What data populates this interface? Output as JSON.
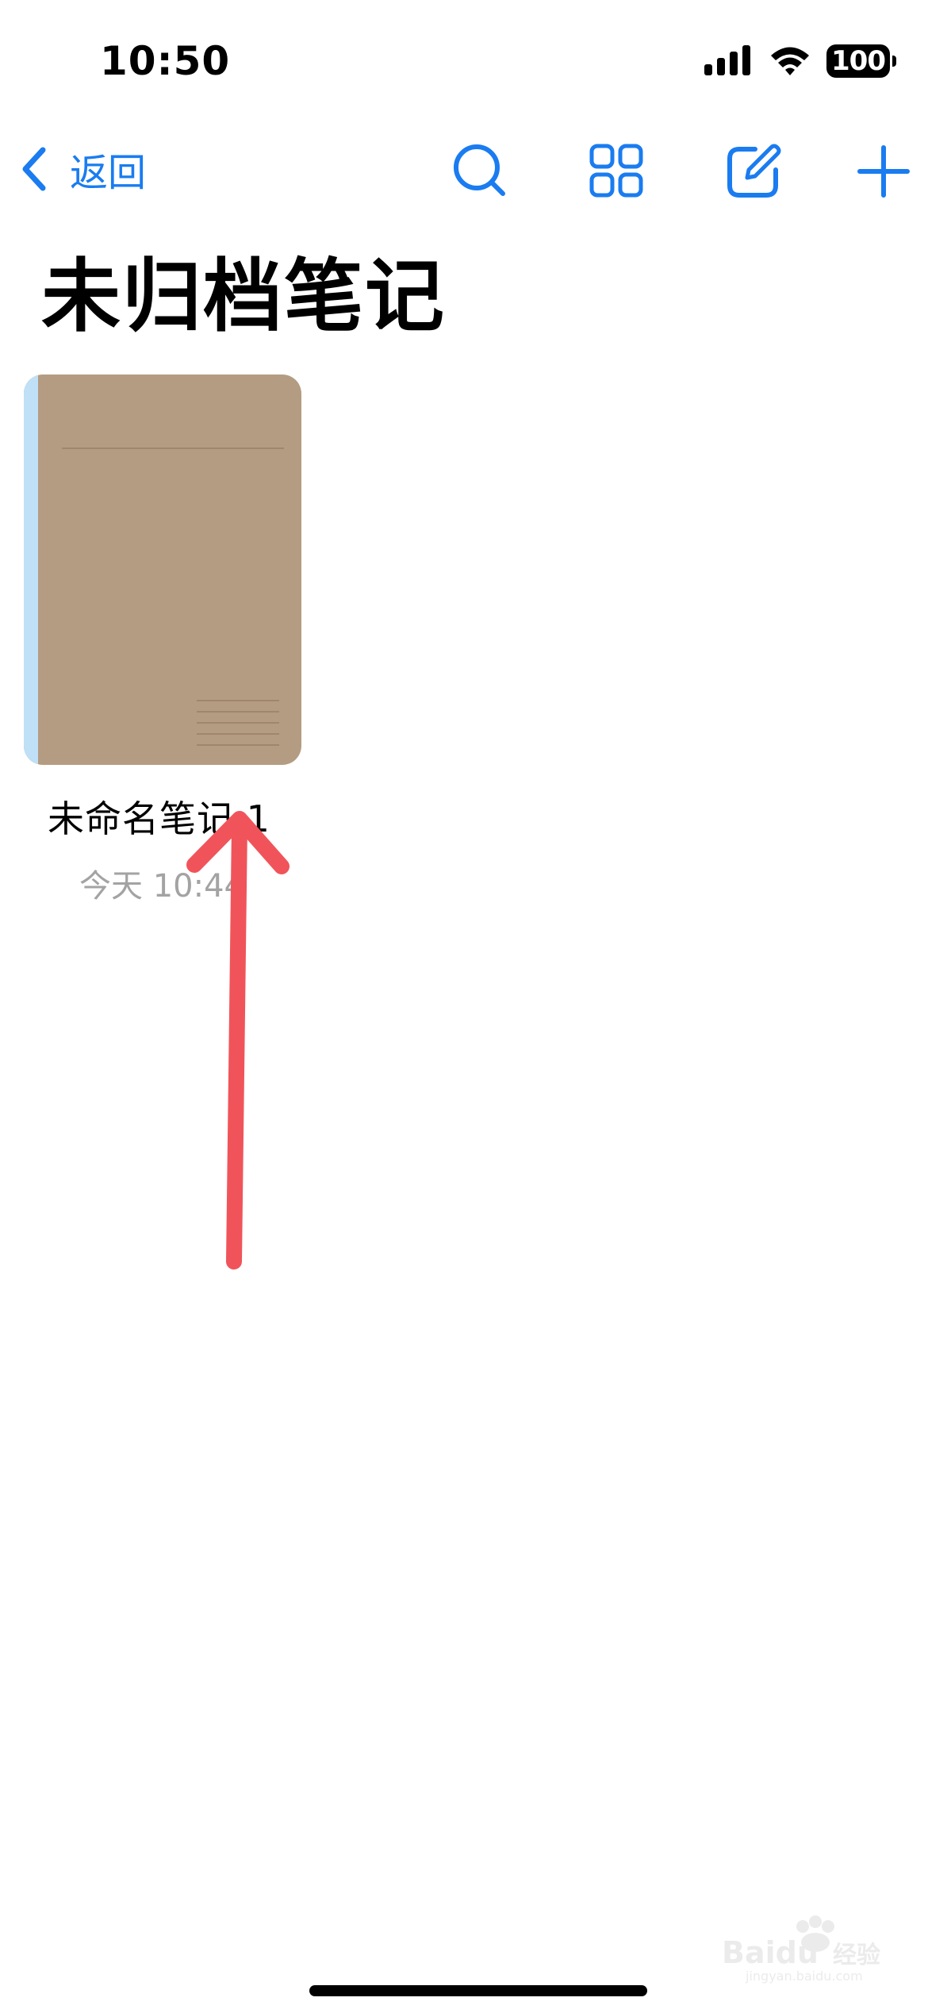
{
  "status_bar": {
    "time": "10:50",
    "battery_level": "100",
    "icons": [
      "signal-icon",
      "wifi-icon",
      "battery-icon"
    ]
  },
  "nav": {
    "back_label": "返回",
    "icons": [
      "search-icon",
      "grid-view-icon",
      "compose-icon",
      "add-icon"
    ],
    "accent_color": "#1a7cf0"
  },
  "page": {
    "title": "未归档笔记"
  },
  "notebooks": [
    {
      "title": "未命名笔记 1",
      "date": "今天 10:44",
      "cover_color": "#b49c82",
      "spine_color": "#bfe0f7"
    }
  ],
  "annotation": {
    "type": "arrow",
    "color": "#f0545a",
    "direction": "up"
  },
  "watermark": {
    "brand": "Baidu经验",
    "url": "jingyan.baidu.com"
  }
}
